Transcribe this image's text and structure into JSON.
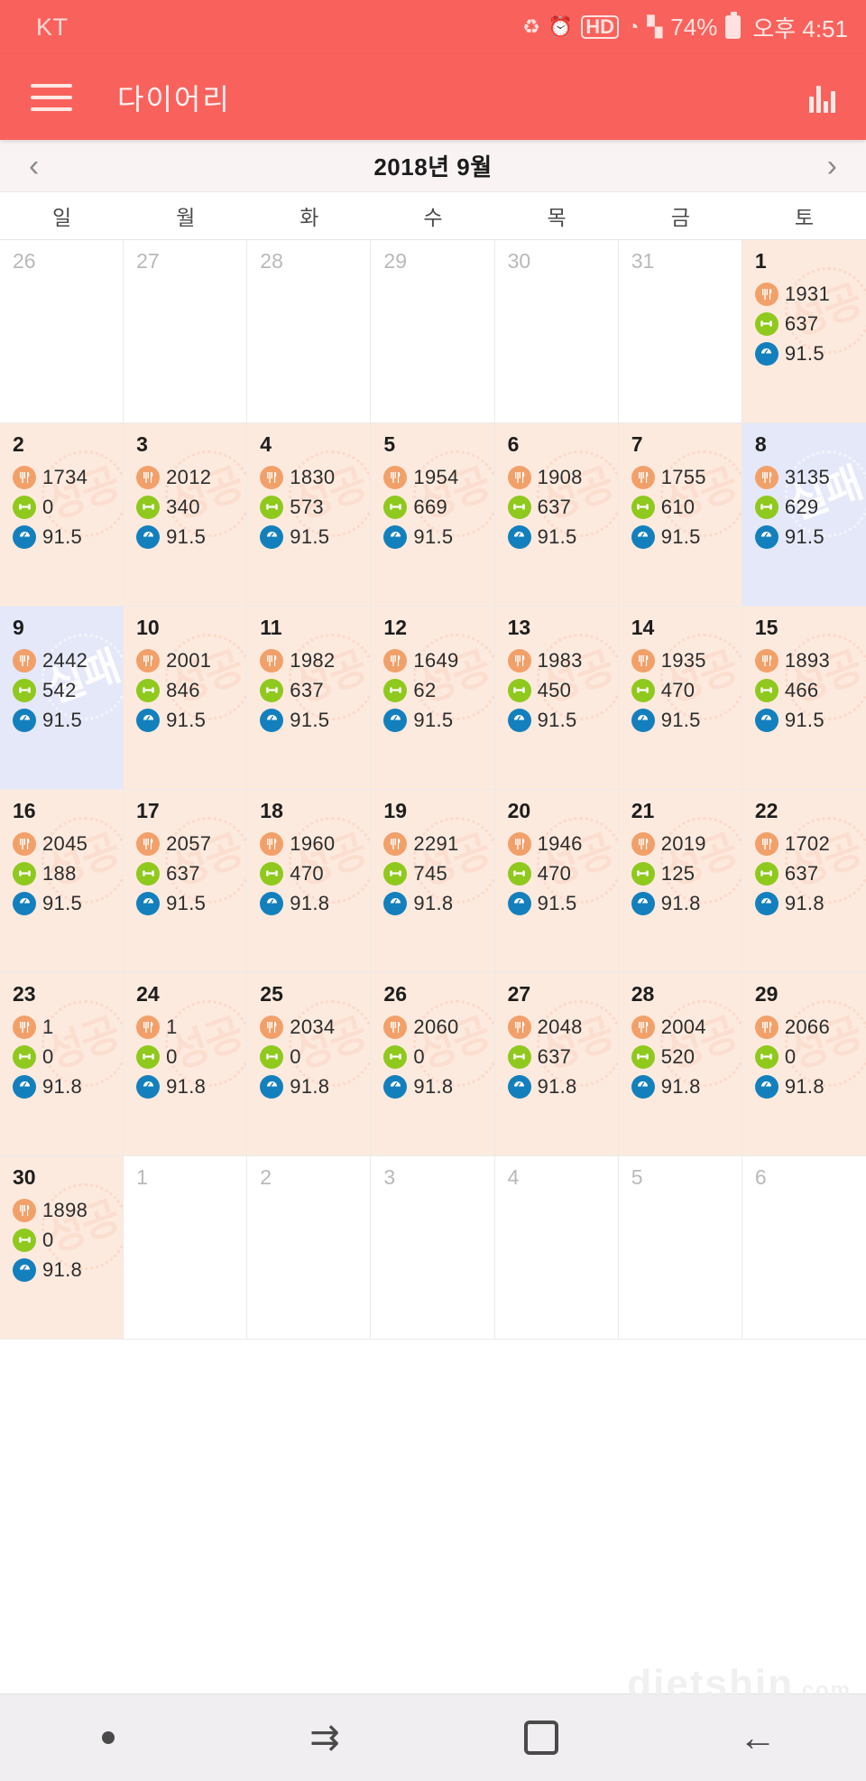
{
  "statusbar": {
    "carrier": "KT",
    "battery_percent": "74%",
    "time": "오후 4:51",
    "icons": [
      "dnd-icon",
      "alarm-icon",
      "hd-icon",
      "wifi-icon",
      "signal-icon",
      "battery-icon"
    ]
  },
  "appbar": {
    "title": "다이어리",
    "menu_icon": "hamburger-icon",
    "chart_icon": "bar-chart-icon"
  },
  "monthnav": {
    "prev": "‹",
    "next": "›",
    "label": "2018년 9월"
  },
  "weekdays": [
    "일",
    "월",
    "화",
    "수",
    "목",
    "금",
    "토"
  ],
  "stamps": {
    "success": "성공",
    "fail": "실패"
  },
  "metric_icons": {
    "food": "food-icon",
    "exercise": "dumbbell-icon",
    "weight": "scale-icon"
  },
  "watermark": {
    "main": "dietshin",
    "suffix": ".com"
  },
  "bottomnav": {
    "items": [
      "dot-indicator",
      "recents-button",
      "home-button",
      "back-button"
    ]
  },
  "calendar": {
    "weeks": [
      [
        {
          "day": "26",
          "state": "empty"
        },
        {
          "day": "27",
          "state": "empty"
        },
        {
          "day": "28",
          "state": "empty"
        },
        {
          "day": "29",
          "state": "empty"
        },
        {
          "day": "30",
          "state": "empty"
        },
        {
          "day": "31",
          "state": "empty"
        },
        {
          "day": "1",
          "state": "success",
          "food": "1931",
          "exercise": "637",
          "weight": "91.5"
        }
      ],
      [
        {
          "day": "2",
          "state": "success",
          "food": "1734",
          "exercise": "0",
          "weight": "91.5"
        },
        {
          "day": "3",
          "state": "success",
          "food": "2012",
          "exercise": "340",
          "weight": "91.5"
        },
        {
          "day": "4",
          "state": "success",
          "food": "1830",
          "exercise": "573",
          "weight": "91.5"
        },
        {
          "day": "5",
          "state": "success",
          "food": "1954",
          "exercise": "669",
          "weight": "91.5"
        },
        {
          "day": "6",
          "state": "success",
          "food": "1908",
          "exercise": "637",
          "weight": "91.5"
        },
        {
          "day": "7",
          "state": "success",
          "food": "1755",
          "exercise": "610",
          "weight": "91.5"
        },
        {
          "day": "8",
          "state": "fail",
          "food": "3135",
          "exercise": "629",
          "weight": "91.5"
        }
      ],
      [
        {
          "day": "9",
          "state": "fail",
          "food": "2442",
          "exercise": "542",
          "weight": "91.5"
        },
        {
          "day": "10",
          "state": "success",
          "food": "2001",
          "exercise": "846",
          "weight": "91.5"
        },
        {
          "day": "11",
          "state": "success",
          "food": "1982",
          "exercise": "637",
          "weight": "91.5"
        },
        {
          "day": "12",
          "state": "success",
          "food": "1649",
          "exercise": "62",
          "weight": "91.5"
        },
        {
          "day": "13",
          "state": "success",
          "food": "1983",
          "exercise": "450",
          "weight": "91.5"
        },
        {
          "day": "14",
          "state": "success",
          "food": "1935",
          "exercise": "470",
          "weight": "91.5"
        },
        {
          "day": "15",
          "state": "success",
          "food": "1893",
          "exercise": "466",
          "weight": "91.5"
        }
      ],
      [
        {
          "day": "16",
          "state": "success",
          "food": "2045",
          "exercise": "188",
          "weight": "91.5"
        },
        {
          "day": "17",
          "state": "success",
          "food": "2057",
          "exercise": "637",
          "weight": "91.5"
        },
        {
          "day": "18",
          "state": "success",
          "food": "1960",
          "exercise": "470",
          "weight": "91.8"
        },
        {
          "day": "19",
          "state": "success",
          "food": "2291",
          "exercise": "745",
          "weight": "91.8"
        },
        {
          "day": "20",
          "state": "success",
          "food": "1946",
          "exercise": "470",
          "weight": "91.5"
        },
        {
          "day": "21",
          "state": "success",
          "food": "2019",
          "exercise": "125",
          "weight": "91.8"
        },
        {
          "day": "22",
          "state": "success",
          "food": "1702",
          "exercise": "637",
          "weight": "91.8"
        }
      ],
      [
        {
          "day": "23",
          "state": "success",
          "food": "1",
          "exercise": "0",
          "weight": "91.8"
        },
        {
          "day": "24",
          "state": "success",
          "food": "1",
          "exercise": "0",
          "weight": "91.8"
        },
        {
          "day": "25",
          "state": "success",
          "food": "2034",
          "exercise": "0",
          "weight": "91.8"
        },
        {
          "day": "26",
          "state": "success",
          "food": "2060",
          "exercise": "0",
          "weight": "91.8"
        },
        {
          "day": "27",
          "state": "success",
          "food": "2048",
          "exercise": "637",
          "weight": "91.8"
        },
        {
          "day": "28",
          "state": "success",
          "food": "2004",
          "exercise": "520",
          "weight": "91.8"
        },
        {
          "day": "29",
          "state": "success",
          "food": "2066",
          "exercise": "0",
          "weight": "91.8"
        }
      ],
      [
        {
          "day": "30",
          "state": "success",
          "food": "1898",
          "exercise": "0",
          "weight": "91.8"
        },
        {
          "day": "1",
          "state": "empty"
        },
        {
          "day": "2",
          "state": "empty"
        },
        {
          "day": "3",
          "state": "empty"
        },
        {
          "day": "4",
          "state": "empty"
        },
        {
          "day": "5",
          "state": "empty"
        },
        {
          "day": "6",
          "state": "empty"
        }
      ]
    ]
  }
}
